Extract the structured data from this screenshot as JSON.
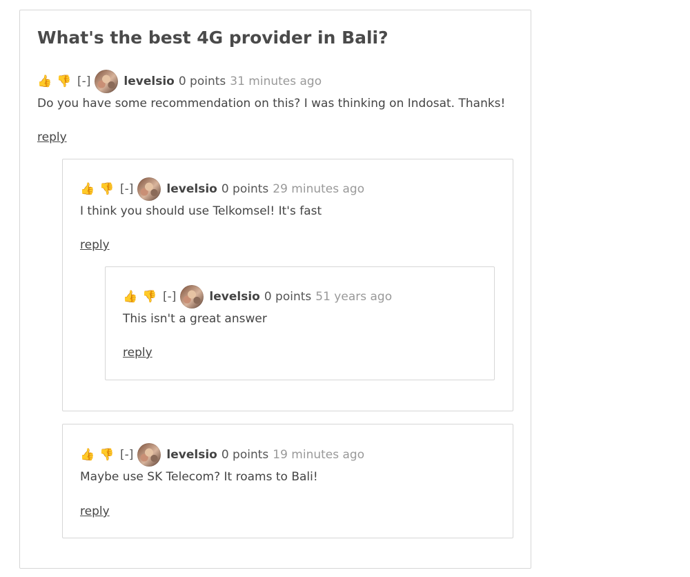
{
  "thread": {
    "title": "What's the best 4G provider in Bali?"
  },
  "comments": [
    {
      "toggle": "[-]",
      "username": "levelsio",
      "points": "0 points",
      "time": "31 minutes ago",
      "text": "Do you have some recommendation on this? I was thinking on Indosat. Thanks!",
      "reply": "reply"
    },
    {
      "toggle": "[-]",
      "username": "levelsio",
      "points": "0 points",
      "time": "29 minutes ago",
      "text": "I think you should use Telkomsel! It's fast",
      "reply": "reply"
    },
    {
      "toggle": "[-]",
      "username": "levelsio",
      "points": "0 points",
      "time": "51 years ago",
      "text": "This isn't a great answer",
      "reply": "reply"
    },
    {
      "toggle": "[-]",
      "username": "levelsio",
      "points": "0 points",
      "time": "19 minutes ago",
      "text": "Maybe use SK Telecom? It roams to Bali!",
      "reply": "reply"
    }
  ],
  "icons": {
    "upvote": "thumbs-up-icon",
    "downvote": "thumbs-down-icon",
    "avatar": "user-avatar"
  }
}
